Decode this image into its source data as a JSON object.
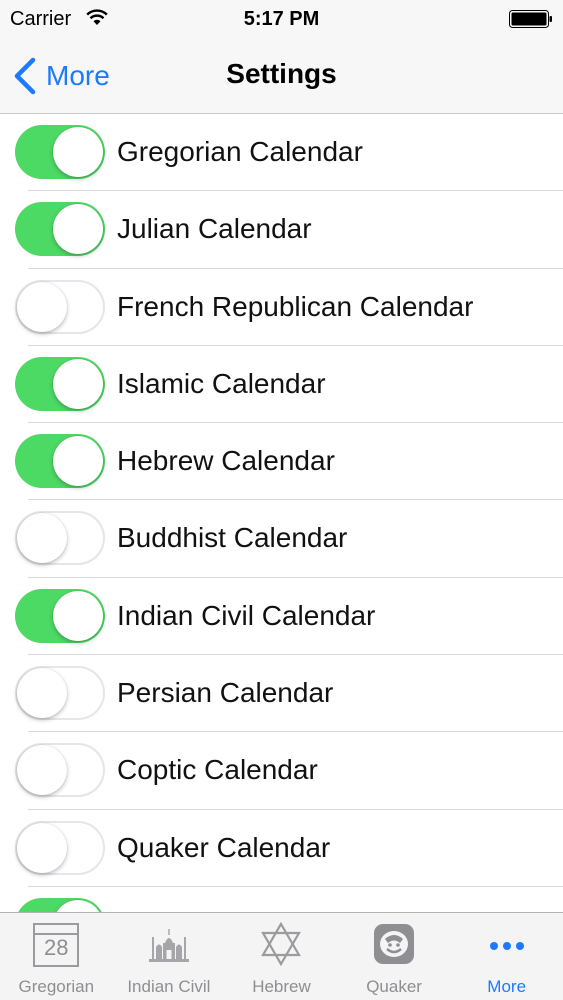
{
  "status_bar": {
    "carrier": "Carrier",
    "time": "5:17 PM"
  },
  "nav": {
    "back_label": "More",
    "title": "Settings"
  },
  "colors": {
    "accent": "#1d7afc",
    "toggle_on": "#4cd964",
    "toggle_off_border": "#e5e5ea"
  },
  "calendars": [
    {
      "label": "Gregorian Calendar",
      "enabled": true
    },
    {
      "label": "Julian Calendar",
      "enabled": true
    },
    {
      "label": "French Republican Calendar",
      "enabled": false
    },
    {
      "label": "Islamic Calendar",
      "enabled": true
    },
    {
      "label": "Hebrew Calendar",
      "enabled": true
    },
    {
      "label": "Buddhist Calendar",
      "enabled": false
    },
    {
      "label": "Indian Civil Calendar",
      "enabled": true
    },
    {
      "label": "Persian Calendar",
      "enabled": false
    },
    {
      "label": "Coptic Calendar",
      "enabled": false
    },
    {
      "label": "Quaker Calendar",
      "enabled": false
    },
    {
      "label": "",
      "enabled": true
    }
  ],
  "tabs": [
    {
      "label": "Gregorian",
      "icon": "calendar-icon",
      "icon_text": "28",
      "active": false
    },
    {
      "label": "Indian Civil",
      "icon": "temple-icon",
      "active": false
    },
    {
      "label": "Hebrew",
      "icon": "star-of-david-icon",
      "active": false
    },
    {
      "label": "Quaker",
      "icon": "quaker-icon",
      "active": false
    },
    {
      "label": "More",
      "icon": "more-dots-icon",
      "active": true
    }
  ]
}
